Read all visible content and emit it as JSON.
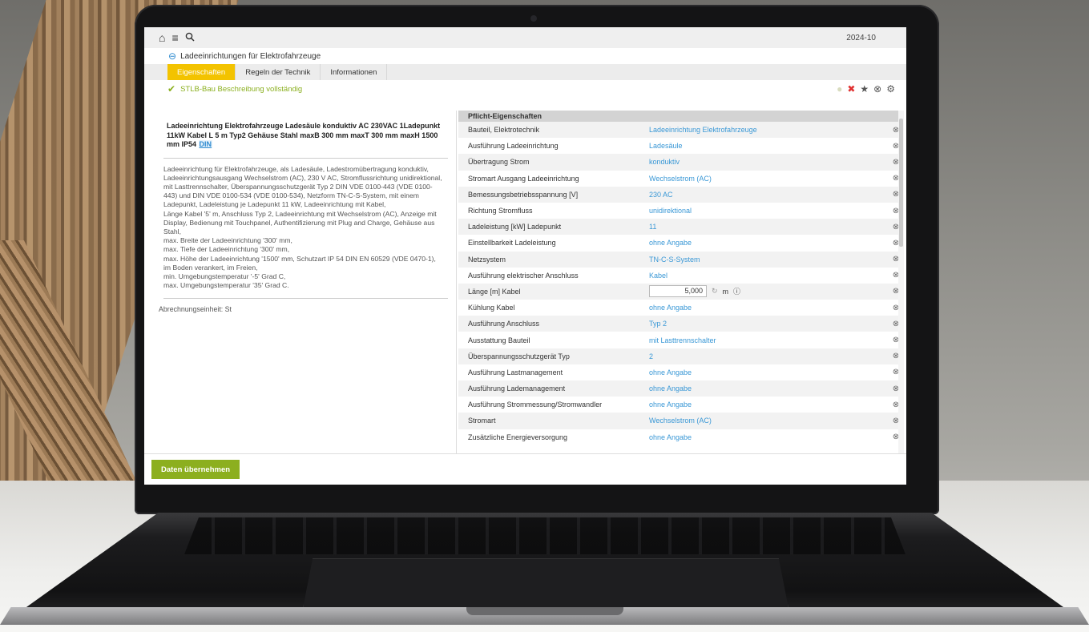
{
  "topbar": {
    "icons": [
      "home-icon",
      "menu-icon",
      "search-icon"
    ],
    "date": "2024-10"
  },
  "breadcrumb": {
    "back_icon": "back-arrow-icon",
    "label": "Ladeeinrichtungen für Elektrofahrzeuge"
  },
  "tabs": [
    {
      "label": "Eigenschaften",
      "active": true
    },
    {
      "label": "Regeln der Technik",
      "active": false
    },
    {
      "label": "Informationen",
      "active": false
    }
  ],
  "status": {
    "icon": "check-icon",
    "text": "STLB-Bau Beschreibung vollständig"
  },
  "toolbar_icons": [
    "confirm-icon",
    "delete-icon",
    "favorite-icon",
    "close-circle-icon",
    "settings-icon"
  ],
  "left": {
    "title": "Ladeeinrichtung Elektrofahrzeuge Ladesäule konduktiv AC 230VAC 1Ladepunkt 11kW Kabel L 5 m Typ2 Gehäuse Stahl maxB 300 mm maxT 300 mm maxH 1500 mm IP54",
    "din_badge": "DIN",
    "description": "Ladeeinrichtung für Elektrofahrzeuge, als Ladesäule, Ladestromübertragung konduktiv, Ladeeinrichtungsausgang Wechselstrom (AC), 230 V AC, Stromflussrichtung unidirektional, mit Lasttrennschalter, Überspannungsschutzgerät Typ 2 DIN VDE 0100-443 (VDE 0100-443) und DIN VDE 0100-534 (VDE 0100-534), Netzform TN-C-S-System, mit einem Ladepunkt, Ladeleistung je Ladepunkt 11 kW, Ladeeinrichtung mit Kabel,\nLänge Kabel '5' m, Anschluss Typ 2, Ladeeinrichtung mit Wechselstrom (AC), Anzeige mit Display, Bedienung mit Touchpanel, Authentifizierung mit Plug and Charge, Gehäuse aus Stahl,\nmax. Breite der Ladeeinrichtung '300' mm,\nmax. Tiefe der Ladeeinrichtung '300' mm,\nmax. Höhe der Ladeeinrichtung '1500' mm, Schutzart IP 54 DIN EN 60529 (VDE 0470-1), im Boden verankert, im Freien,\nmin. Umgebungstemperatur '-5' Grad C,\nmax. Umgebungstemperatur '35' Grad C.",
    "billing_unit": "Abrechnungseinheit: St"
  },
  "properties": {
    "header": "Pflicht-Eigenschaften",
    "rows": [
      {
        "label": "Bauteil, Elektrotechnik",
        "value": "Ladeeinrichtung Elektrofahrzeuge"
      },
      {
        "label": "Ausführung Ladeeinrichtung",
        "value": "Ladesäule"
      },
      {
        "label": "Übertragung Strom",
        "value": "konduktiv"
      },
      {
        "label": "Stromart Ausgang Ladeeinrichtung",
        "value": "Wechselstrom (AC)"
      },
      {
        "label": "Bemessungsbetriebsspannung [V]",
        "value": "230 AC"
      },
      {
        "label": "Richtung Stromfluss",
        "value": "unidirektional"
      },
      {
        "label": "Ladeleistung [kW] Ladepunkt",
        "value": "11"
      },
      {
        "label": "Einstellbarkeit Ladeleistung",
        "value": "ohne Angabe"
      },
      {
        "label": "Netzsystem",
        "value": "TN-C-S-System"
      },
      {
        "label": "Ausführung elektrischer Anschluss",
        "value": "Kabel"
      },
      {
        "label": "Länge [m] Kabel",
        "value": "5,000",
        "unit": "m",
        "input": true
      },
      {
        "label": "Kühlung Kabel",
        "value": "ohne Angabe"
      },
      {
        "label": "Ausführung Anschluss",
        "value": "Typ 2"
      },
      {
        "label": "Ausstattung Bauteil",
        "value": "mit Lasttrennschalter"
      },
      {
        "label": "Überspannungsschutzgerät Typ",
        "value": "2"
      },
      {
        "label": "Ausführung Lastmanagement",
        "value": "ohne Angabe"
      },
      {
        "label": "Ausführung Lademanagement",
        "value": "ohne Angabe"
      },
      {
        "label": "Ausführung Strommessung/Stromwandler",
        "value": "ohne Angabe"
      },
      {
        "label": "Stromart",
        "value": "Wechselstrom (AC)"
      },
      {
        "label": "Zusätzliche Energieversorgung",
        "value": "ohne Angabe"
      }
    ]
  },
  "footer": {
    "save_label": "Daten übernehmen"
  }
}
